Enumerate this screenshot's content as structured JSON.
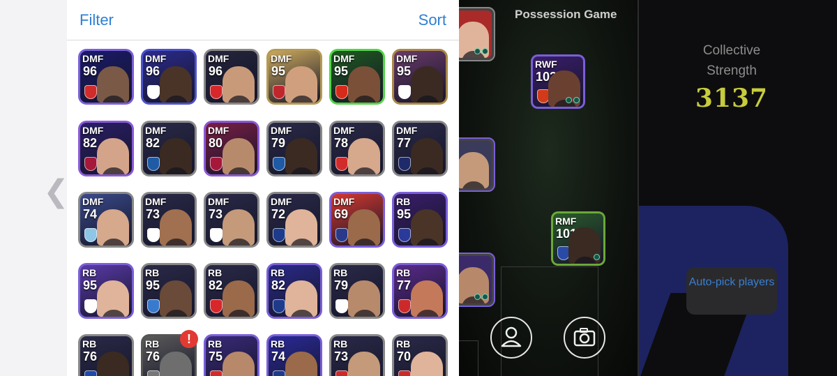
{
  "header": {
    "filter_label": "Filter",
    "sort_label": "Sort"
  },
  "nav": {
    "back_icon": "chevron-left-icon",
    "back_glyph": "❮"
  },
  "players": [
    {
      "pos": "DMF",
      "rating": "96",
      "border": "#7a5fd8",
      "bg": "#1a1a6a",
      "badge": "#d22b2b",
      "face": "#7a5a46"
    },
    {
      "pos": "DMF",
      "rating": "96",
      "border": "#4c52c8",
      "bg": "#2b2b8d",
      "badge": "#ffffff",
      "face": "#4a3428"
    },
    {
      "pos": "DMF",
      "rating": "96",
      "border": "#888888",
      "bg": "#24243a",
      "badge": "#d7272a",
      "face": "#c99a7a"
    },
    {
      "pos": "DMF",
      "rating": "95",
      "border": "#b59a55",
      "bg": "#caa85c",
      "badge": "#c0272d",
      "face": "#d0a07e"
    },
    {
      "pos": "DMF",
      "rating": "95",
      "border": "#55d44a",
      "bg": "#1e5a1e",
      "badge": "#d62a1a",
      "face": "#7b5038"
    },
    {
      "pos": "DMF",
      "rating": "95",
      "border": "#a98848",
      "bg": "#6a3a68",
      "badge": "#ffffff",
      "face": "#3a2a22"
    },
    {
      "pos": "DMF",
      "rating": "82",
      "border": "#8a5ad8",
      "bg": "#2a1e66",
      "badge": "#a5183a",
      "face": "#d4a48a"
    },
    {
      "pos": "DMF",
      "rating": "82",
      "border": "#888888",
      "bg": "#2a2a48",
      "badge": "#1f5aa5",
      "face": "#3a2a22"
    },
    {
      "pos": "DMF",
      "rating": "80",
      "border": "#8a5ad8",
      "bg": "#7a1e44",
      "badge": "#a5183a",
      "face": "#b88a6c"
    },
    {
      "pos": "DMF",
      "rating": "79",
      "border": "#888888",
      "bg": "#2a2a48",
      "badge": "#1f5aa5",
      "face": "#3a2a22"
    },
    {
      "pos": "DMF",
      "rating": "78",
      "border": "#888888",
      "bg": "#2a2a48",
      "badge": "#d22b2b",
      "face": "#d6a88c"
    },
    {
      "pos": "DMF",
      "rating": "77",
      "border": "#888888",
      "bg": "#2a2a48",
      "badge": "#1e2a6a",
      "face": "#3a2a22"
    },
    {
      "pos": "DMF",
      "rating": "74",
      "border": "#888888",
      "bg": "#3a4a8a",
      "badge": "#8ec6e6",
      "face": "#d6a88c"
    },
    {
      "pos": "DMF",
      "rating": "73",
      "border": "#888888",
      "bg": "#2a2a48",
      "badge": "#ffffff",
      "face": "#a07050"
    },
    {
      "pos": "DMF",
      "rating": "73",
      "border": "#888888",
      "bg": "#2a2a48",
      "badge": "#ffffff",
      "face": "#c49a7a"
    },
    {
      "pos": "DMF",
      "rating": "72",
      "border": "#888888",
      "bg": "#2a2a48",
      "badge": "#1e3a8a",
      "face": "#e0b49a"
    },
    {
      "pos": "DMF",
      "rating": "69",
      "border": "#7a5fd8",
      "bg": "#d3382e",
      "badge": "#2a3a8a",
      "face": "#9a6a4a"
    },
    {
      "pos": "RB",
      "rating": "95",
      "border": "#7a5fd8",
      "bg": "#3a1e6a",
      "badge": "#2a3a9a",
      "face": "#4a3428"
    },
    {
      "pos": "RB",
      "rating": "95",
      "border": "#7a5fd8",
      "bg": "#5a3aa8",
      "badge": "#ffffff",
      "face": "#e0b49a"
    },
    {
      "pos": "RB",
      "rating": "95",
      "border": "#888888",
      "bg": "#2a2a48",
      "badge": "#3a7acc",
      "face": "#6a4a38"
    },
    {
      "pos": "RB",
      "rating": "82",
      "border": "#888888",
      "bg": "#2a2a48",
      "badge": "#d7272a",
      "face": "#9a6a4a"
    },
    {
      "pos": "RB",
      "rating": "82",
      "border": "#7a5fd8",
      "bg": "#2a2a8a",
      "badge": "#1e3a8a",
      "face": "#e0b49a"
    },
    {
      "pos": "RB",
      "rating": "79",
      "border": "#888888",
      "bg": "#2a2a48",
      "badge": "#ffffff",
      "face": "#b88a6c"
    },
    {
      "pos": "RB",
      "rating": "77",
      "border": "#7a5fd8",
      "bg": "#5a2a8a",
      "badge": "#cc2a2a",
      "face": "#c47a5a"
    },
    {
      "pos": "RB",
      "rating": "76",
      "border": "#888888",
      "bg": "#2a2a48",
      "badge": "#1e4aaa",
      "face": "#3a2a22"
    },
    {
      "pos": "RB",
      "rating": "76",
      "border": "#555555",
      "bg": "#5a5a5a",
      "badge": "#777777",
      "face": "#6e6e6e",
      "alert": "!"
    },
    {
      "pos": "RB",
      "rating": "75",
      "border": "#7a5fd8",
      "bg": "#3a2a7a",
      "badge": "#d22b2b",
      "face": "#b8886a"
    },
    {
      "pos": "RB",
      "rating": "74",
      "border": "#7a5fd8",
      "bg": "#2a2a9a",
      "badge": "#1e3a8a",
      "face": "#9a6a4a"
    },
    {
      "pos": "RB",
      "rating": "73",
      "border": "#888888",
      "bg": "#2a2a48",
      "badge": "#cc2a2a",
      "face": "#c49a7a"
    },
    {
      "pos": "RB",
      "rating": "70",
      "border": "#888888",
      "bg": "#2a2a48",
      "badge": "#cc2a2a",
      "face": "#e0b49a"
    }
  ],
  "game": {
    "title": "Possession Game",
    "pitch_players": [
      {
        "pos": "RWF",
        "rating": "103",
        "border": "#7a5fd8",
        "bg": "#3a1e6a",
        "badge": "#d23a1a",
        "face": "#6a4030"
      },
      {
        "pos": "RMF",
        "rating": "101",
        "border": "#6ba83a",
        "bg": "#2a5a2a",
        "badge": "#2a4aa8",
        "face": "#3a2a22"
      }
    ],
    "collective_label": "Collective Strength",
    "collective_value": "3137",
    "autopick_label": "Auto-pick players",
    "profile_icon": "user-icon",
    "camera_icon": "camera-icon"
  }
}
